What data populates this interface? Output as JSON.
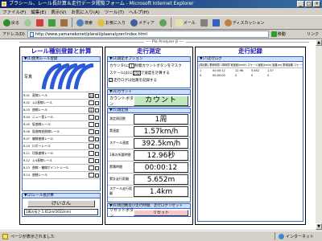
{
  "window": {
    "title": "プラシール、レール長計算＆走行データ閲覧フォーム - Microsoft Internet Explorer",
    "min": "_",
    "max": "□",
    "close": "×"
  },
  "menu": [
    "ファイル(F)",
    "編集(E)",
    "表示(V)",
    "お気に入り(A)",
    "ツール(T)",
    "ヘルプ(H)"
  ],
  "toolbar": {
    "back": "戻る",
    "forward": "",
    "stop": "",
    "refresh": "",
    "home": "",
    "search": "検索",
    "favorites": "お気に入り",
    "media": "メディア",
    "history": "",
    "mail": "メール",
    "print": "",
    "edit": "",
    "discuss": "ディスカッション"
  },
  "address": {
    "label": "アドレス(D)",
    "url": "http://www.yamanekonet/plarail/plaanalyzer/index.html",
    "go": "移動",
    "links": "リンク"
  },
  "frame_title": "---- Pla Analyzer β ----",
  "left": {
    "title": "レール種別登録と計算",
    "sec1": "▼(1)使用レール登録",
    "photo": "写真",
    "rails": [
      {
        "id": "R-01",
        "name": "直線レール",
        "count": "20"
      },
      {
        "id": "R-02",
        "name": "1/2直線レール",
        "count": ""
      },
      {
        "id": "R-03",
        "name": "曲線レール",
        "count": "8"
      },
      {
        "id": "R-04",
        "name": "ニュー直レール",
        "count": ""
      },
      {
        "id": "R-05",
        "name": "坂曲線レール",
        "count": ""
      },
      {
        "id": "R-06",
        "name": "坂曲線逆曲線レール",
        "count": ""
      },
      {
        "id": "R-07",
        "name": "複線曲線レール",
        "count": ""
      },
      {
        "id": "R-10",
        "name": "ロボーレール",
        "count": ""
      },
      {
        "id": "R-11",
        "name": "切換曲線レール",
        "count": ""
      },
      {
        "id": "R-12",
        "name": "1/4直線レール",
        "count": ""
      },
      {
        "id": "R-13",
        "name": "曲線・複線ポイントレール",
        "count": ""
      },
      {
        "id": "R-14",
        "name": "曲線レール",
        "count": ""
      }
    ],
    "sec2": "▼(2)レール長計算",
    "calc_button": "けいさん",
    "result": "1周の長さ 5.652m(5652mm)"
  },
  "mid": {
    "title": "走行測定",
    "opt_h": "▼(3)測定オプション",
    "counter_label": "カウンタ(に",
    "counter_value": "1",
    "counter_suffix": "秒間カウントボタンをマスク",
    "scale_label": "スケールは(に",
    "scale_value": "250",
    "scale_suffix": "で速度を計算する",
    "log_label": "走行ログは往路を記録する",
    "count_h": "▼(4)カウント",
    "count_label": "カウントボタン",
    "count_button": "カウント",
    "res_h": "▼(5)測定値",
    "metrics": [
      {
        "label": "測定周回数",
        "value": "1周"
      },
      {
        "label": "実速度",
        "value": "1.57km/h"
      },
      {
        "label": "スケール速度",
        "value": "392.5km/h"
      },
      {
        "label": "1周の所要時間",
        "value": "12.96秒"
      },
      {
        "label": "累積時間",
        "value": "00:00:12"
      },
      {
        "label": "累計走行距離",
        "value": "5.652m"
      },
      {
        "label": "スケール走行距離",
        "value": "1.4km"
      }
    ],
    "reset_h": "▼(6)周回数及び走行時間、走行ログリセット",
    "reset_label": "リセットボタン",
    "reset_button": "リセット"
  },
  "right": {
    "title": "走行記録",
    "log_h": "▼(7)走行ログ",
    "log_header": "[周回数] 累積時間 1周時間 実速度(km/h) スケール速度(km/h) 距離(m) 累積距離 スケール距離",
    "log_rows": [
      {
        "c1": "1",
        "c2": "00:00:12",
        "c3": "12.96",
        "c4": "5.652",
        "c5": "1.57"
      },
      {
        "c1": "0",
        "c2": "00:00:00",
        "c3": "0",
        "c4": "0",
        "c5": "0"
      }
    ]
  },
  "status": {
    "text": "ページが表示されました",
    "zone": "インターネット"
  },
  "colors": {
    "title_blue": "#0a246a",
    "panel_title": "#1a1ab8",
    "count_green": "#bfe8bf",
    "reset_pink": "#f4c8c8"
  }
}
